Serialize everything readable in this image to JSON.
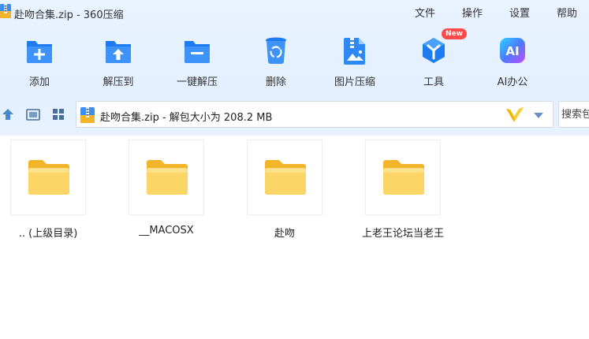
{
  "window": {
    "title": "赴吻合集.zip - 360压缩"
  },
  "menu": [
    "文件",
    "操作",
    "设置",
    "帮助"
  ],
  "toolbar": {
    "items": [
      {
        "label": "添加",
        "icon": "add-icon"
      },
      {
        "label": "解压到",
        "icon": "extract-to-icon"
      },
      {
        "label": "一键解压",
        "icon": "one-click-extract-icon"
      },
      {
        "label": "删除",
        "icon": "delete-icon"
      },
      {
        "label": "图片压缩",
        "icon": "image-compress-icon"
      },
      {
        "label": "工具",
        "icon": "tools-icon",
        "badge": "New"
      },
      {
        "label": "AI办公",
        "icon": "ai-office-icon",
        "icon_text": "AI"
      }
    ]
  },
  "address": {
    "text": "赴吻合集.zip - 解包大小为 208.2 MB"
  },
  "search": {
    "placeholder": "搜索包"
  },
  "files": [
    {
      "name": ".. (上级目录)"
    },
    {
      "name": "__MACOSX"
    },
    {
      "name": "赴吻"
    },
    {
      "name": "上老王论坛当老王"
    }
  ],
  "colors": {
    "accent_blue": "#1e7bf0",
    "folder_yellow": "#f7c948",
    "badge_red": "#ff4a4a"
  }
}
